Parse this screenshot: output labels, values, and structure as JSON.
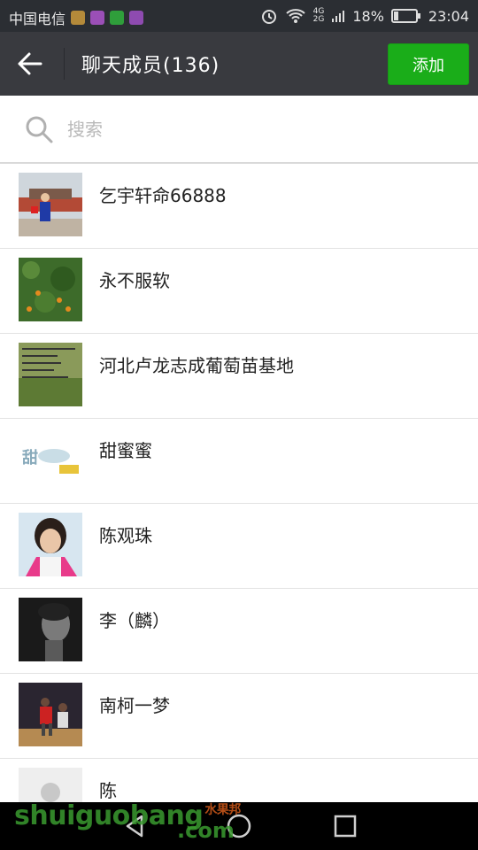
{
  "status_bar": {
    "carrier": "中国电信",
    "network_top": "4G",
    "network_bottom": "2G",
    "battery": "18%",
    "time": "23:04"
  },
  "header": {
    "title": "聊天成员(136)",
    "add_label": "添加"
  },
  "search": {
    "placeholder": "搜索"
  },
  "members": [
    {
      "name": "乞宇轩命66888"
    },
    {
      "name": "永不服软"
    },
    {
      "name": "河北卢龙志成葡萄苗基地"
    },
    {
      "name": "甜蜜蜜"
    },
    {
      "name": "陈观珠"
    },
    {
      "name": "李（麟）"
    },
    {
      "name": "南柯一梦"
    },
    {
      "name": "陈"
    }
  ],
  "watermark": {
    "text": "shuiguobang",
    "tag": "水果邦",
    "domain": ".com"
  },
  "colors": {
    "header_bg": "#393a3f",
    "accent_green": "#1aad19",
    "status_bg": "#2b2e33"
  }
}
